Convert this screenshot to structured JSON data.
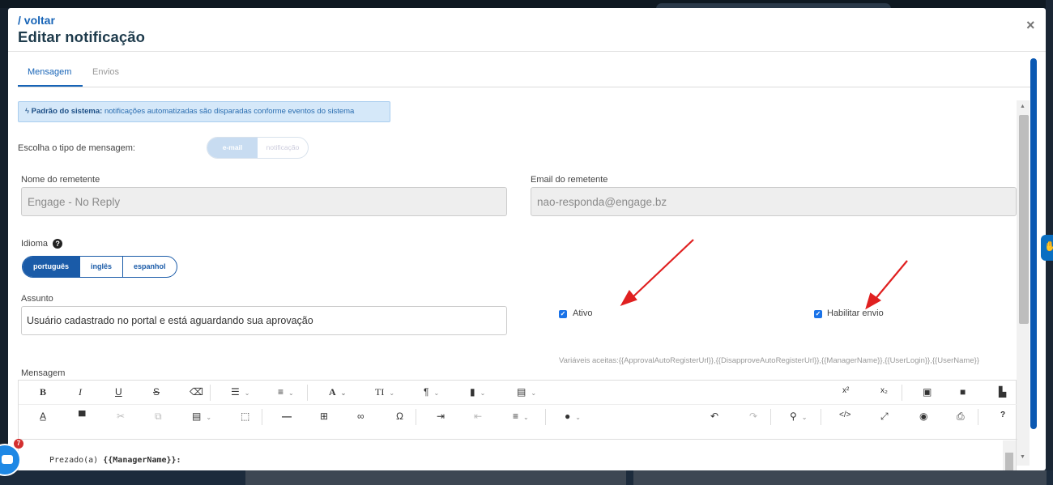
{
  "header": {
    "back_link": "/ voltar",
    "title": "Editar notificação",
    "close": "×"
  },
  "tabs": [
    {
      "label": "Mensagem",
      "active": true
    },
    {
      "label": "Envios",
      "active": false
    }
  ],
  "alert": {
    "icon": "bolt-icon",
    "bold": "Padrão do sistema:",
    "text": " notificações automatizadas são disparadas conforme eventos do sistema"
  },
  "message_type": {
    "label": "Escolha o tipo de mensagem:",
    "options": [
      "e-mail",
      "notificação"
    ],
    "selected": "e-mail"
  },
  "sender": {
    "name_label": "Nome do remetente",
    "name_value": "Engage - No Reply",
    "email_label": "Email do remetente",
    "email_value": "nao-responda@engage.bz"
  },
  "language": {
    "label": "Idioma",
    "help": "?",
    "options": [
      "português",
      "inglês",
      "espanhol"
    ],
    "selected": "português"
  },
  "subject": {
    "label": "Assunto",
    "value": "Usuário cadastrado no portal e está aguardando sua aprovação"
  },
  "checkboxes": {
    "ativo": {
      "label": "Ativo",
      "checked": true
    },
    "habilitar": {
      "label": "Habilitar envio",
      "checked": true
    }
  },
  "variables_text": "Variáveis aceitas:{{ApprovalAutoRegisterUrl}},{{DisapproveAutoRegisterUrl}},{{ManagerName}},{{UserLogin}},{{UserName}}",
  "editor": {
    "label": "Mensagem",
    "content_prefix": "Prezado(a) ",
    "content_var": "{{ManagerName}}:"
  },
  "chat": {
    "badge": "7"
  },
  "colors": {
    "accent": "#1764b7",
    "arrow": "#e02020",
    "alert_bg": "#d5e8f9"
  }
}
